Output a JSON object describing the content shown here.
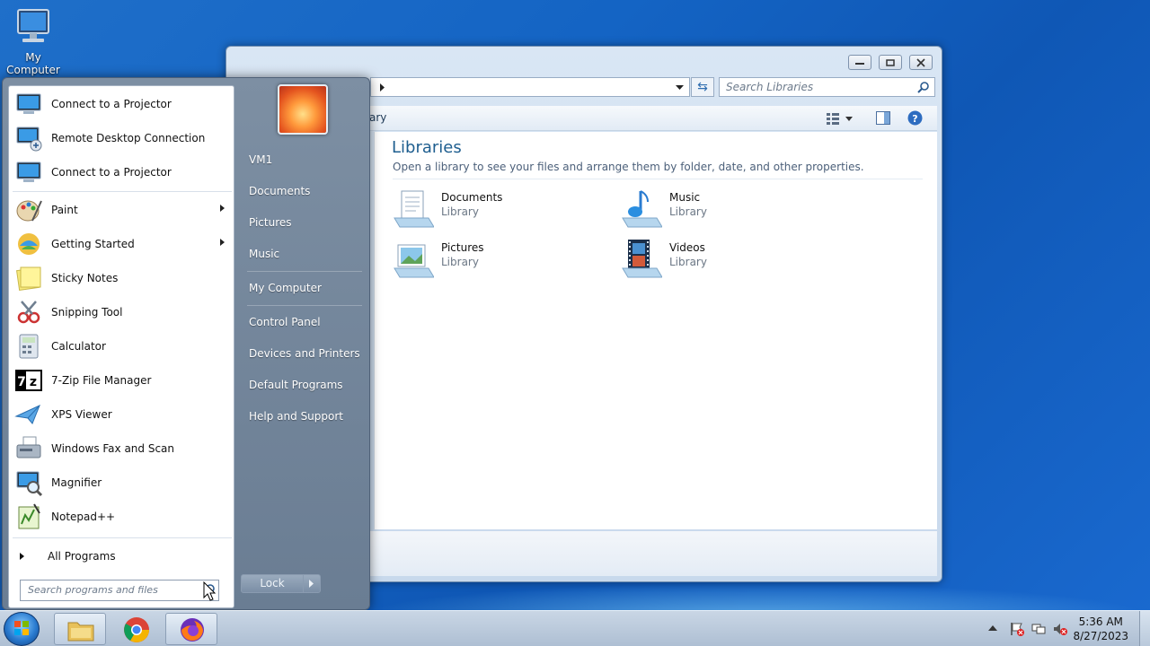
{
  "desktop": {
    "icon_label": "My Computer"
  },
  "explorer": {
    "search_placeholder": "Search Libraries",
    "toolbar_partial": "ary",
    "title": "Libraries",
    "subtitle": "Open a library to see your files and arrange them by folder, date, and other properties.",
    "libraries": [
      {
        "name": "Documents",
        "type": "Library"
      },
      {
        "name": "Music",
        "type": "Library"
      },
      {
        "name": "Pictures",
        "type": "Library"
      },
      {
        "name": "Videos",
        "type": "Library"
      }
    ]
  },
  "start_menu": {
    "programs": [
      {
        "label": "Connect to a Projector",
        "icon": "projector-icon"
      },
      {
        "label": "Remote Desktop Connection",
        "icon": "remote-desktop-icon"
      },
      {
        "label": "Connect to a Projector",
        "icon": "projector-icon"
      },
      {
        "label": "Paint",
        "icon": "paint-icon"
      },
      {
        "label": "Getting Started",
        "icon": "getting-started-icon"
      },
      {
        "label": "Sticky Notes",
        "icon": "sticky-notes-icon"
      },
      {
        "label": "Snipping Tool",
        "icon": "snipping-tool-icon"
      },
      {
        "label": "Calculator",
        "icon": "calculator-icon"
      },
      {
        "label": "7-Zip File Manager",
        "icon": "7zip-icon"
      },
      {
        "label": "XPS Viewer",
        "icon": "xps-viewer-icon"
      },
      {
        "label": "Windows Fax and Scan",
        "icon": "fax-icon"
      },
      {
        "label": "Magnifier",
        "icon": "magnifier-icon"
      },
      {
        "label": "Notepad++",
        "icon": "notepadpp-icon"
      }
    ],
    "all_programs": "All Programs",
    "search_placeholder": "Search programs and files",
    "right_items": [
      "VM1",
      "Documents",
      "Pictures",
      "Music",
      "My Computer",
      "Control Panel",
      "Devices and Printers",
      "Default Programs",
      "Help and Support"
    ],
    "lock_label": "Lock"
  },
  "taskbar": {
    "time": "5:36 AM",
    "date": "8/27/2023"
  }
}
